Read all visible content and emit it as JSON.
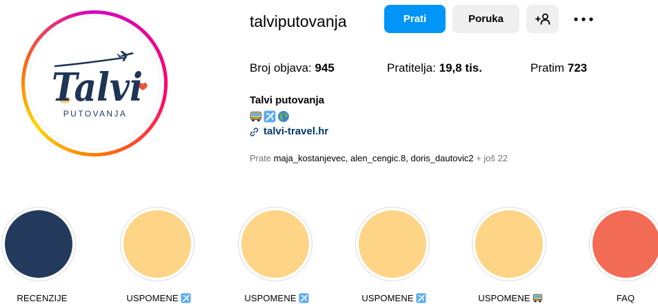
{
  "theme": {
    "accent": "#0095f6",
    "secondary_bg": "#efefef",
    "link_color": "#00376b",
    "muted_text": "#737373",
    "logo_navy": "#1f3556",
    "logo_accent": "#f2b95b",
    "logo_dot": "#e9573f"
  },
  "profile": {
    "username": "talviputovanja",
    "avatar_logo_text": "Talvi",
    "avatar_logo_subtitle": "PUTOVANJA"
  },
  "actions": {
    "follow_label": "Prati",
    "message_label": "Poruka",
    "suggest_icon": "add-person-icon",
    "more_icon": "more-dots-icon"
  },
  "stats": {
    "posts_label": "Broj objava:",
    "posts_value": "945",
    "followers_label": "Pratitelja:",
    "followers_value": "19,8 tis.",
    "following_label": "Pratim",
    "following_value": "723"
  },
  "bio": {
    "full_name": "Talvi putovanja",
    "emojis": [
      "bus-emoji",
      "airplane-emoji",
      "globe-emoji"
    ],
    "link_icon": "link-icon",
    "link_text": "talvi-travel.hr"
  },
  "followed_by": {
    "prefix": "Prate",
    "names": [
      "maja_kostanjevec",
      "alen_cengic.8",
      "doris_dautovic2"
    ],
    "suffix": "+ još 22"
  },
  "highlights": [
    {
      "label": "RECENZIJE",
      "color": "#233a5c",
      "icon": null
    },
    {
      "label": "USPOMENE",
      "color": "#fed587",
      "icon": "airplane-emoji"
    },
    {
      "label": "USPOMENE",
      "color": "#fed587",
      "icon": "airplane-emoji"
    },
    {
      "label": "USPOMENE",
      "color": "#fed587",
      "icon": "airplane-emoji"
    },
    {
      "label": "USPOMENE",
      "color": "#fed587",
      "icon": "bus-emoji"
    },
    {
      "label": "FAQ",
      "color": "#f26c55",
      "icon": null
    }
  ]
}
